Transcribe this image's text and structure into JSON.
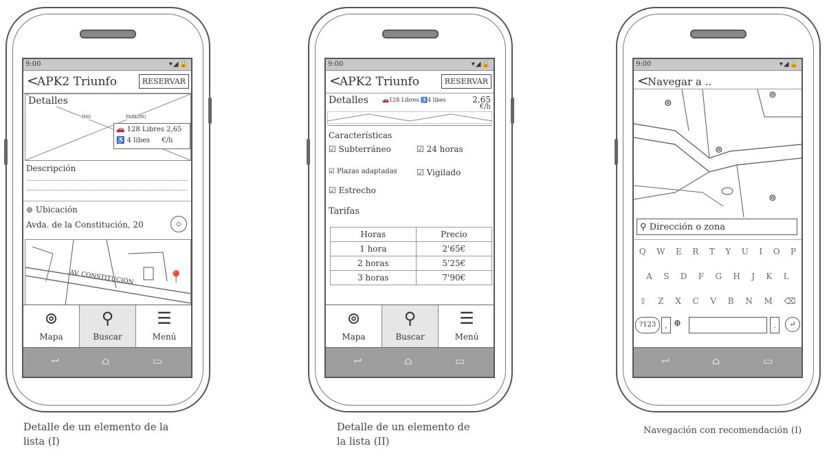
{
  "common": {
    "time": "9:00",
    "back_glyph": "<",
    "status_icons": "▾◢🔒",
    "nav": {
      "back": "↩",
      "home": "⌂",
      "recent": "▭"
    }
  },
  "phone1": {
    "title": "APK2 Triunfo",
    "reserve": "RESERVAR",
    "detalles": "Detalles",
    "img_label": "IMG",
    "parking_label": "PARKING",
    "libres": "128 Libres",
    "adaptadas": "4 libes",
    "price": "2,65",
    "price_unit": "€/h",
    "descripcion": "Descripción",
    "ubicacion": "Ubicación",
    "address": "Avda. de la Constitución, 20",
    "map_street": "AV. CONSTITUCIÓN",
    "tabs": [
      "Mapa",
      "Buscar",
      "Menú"
    ]
  },
  "phone2": {
    "title": "APK2 Triunfo",
    "reserve": "RESERVAR",
    "detalles": "Detalles",
    "libres": "128 Libres",
    "adaptadas": "4 libes",
    "price": "2,65",
    "price_unit": "€/h",
    "caracteristicas": "Características",
    "checks": [
      "Subterráneo",
      "24 horas",
      "Plazas adaptadas",
      "Vigilado",
      "Estrecho"
    ],
    "tarifas": "Tarifas",
    "rates_header": [
      "Horas",
      "Precio"
    ],
    "rates": [
      [
        "1 hora",
        "2'65€"
      ],
      [
        "2 horas",
        "5'25€"
      ],
      [
        "3 horas",
        "7'90€"
      ]
    ],
    "tabs": [
      "Mapa",
      "Buscar",
      "Menú"
    ]
  },
  "phone3": {
    "title": "Navegar a ..",
    "search_placeholder": "Dirección o zona",
    "kb_row1": [
      "Q",
      "W",
      "E",
      "R",
      "T",
      "Y",
      "U",
      "I",
      "O",
      "P"
    ],
    "kb_row2": [
      "A",
      "S",
      "D",
      "F",
      "G",
      "H",
      "J",
      "K",
      "L"
    ],
    "kb_row3": [
      "⇧",
      "Z",
      "X",
      "C",
      "V",
      "B",
      "N",
      "M",
      "⌫"
    ],
    "kb_sym": "?123",
    "kb_comma": ",",
    "kb_globe": "⊕",
    "kb_dot": ".",
    "kb_enter": "↵"
  },
  "captions": {
    "c1_line1": "Detalle de un elemento de la",
    "c1_line2": "lista (I)",
    "c2_line1": "Detalle de un elemento de",
    "c2_line2": "la lista (II)",
    "c3": "Navegación con recomendación (I)"
  }
}
